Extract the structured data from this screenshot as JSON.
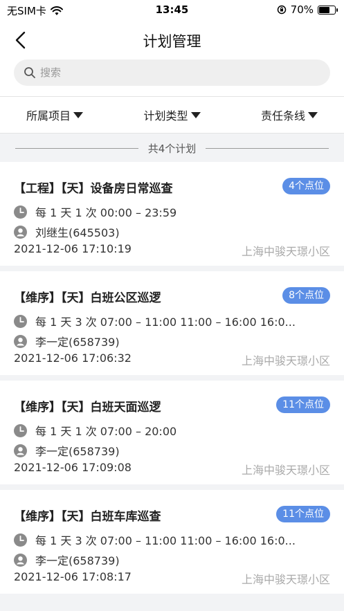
{
  "status_bar": {
    "carrier": "无SIM卡",
    "time": "13:45",
    "battery": "70%",
    "battery_level": 0.7
  },
  "header": {
    "title": "计划管理",
    "search_placeholder": "搜索"
  },
  "filters": [
    {
      "label": "所属项目"
    },
    {
      "label": "计划类型"
    },
    {
      "label": "责任条线"
    }
  ],
  "summary": "共4个计划",
  "plans": [
    {
      "name": "【工程】【天】设备房日常巡查",
      "badge": "4个点位",
      "frequency": "每 1 天 1 次   00:00 – 23:59",
      "person": "刘继生(645503)",
      "datetime": "2021-12-06 17:10:19",
      "area": "上海中骏天璟小区"
    },
    {
      "name": "【维序】【天】白班公区巡逻",
      "badge": "8个点位",
      "frequency": "每 1 天 3 次   07:00 – 11:00   11:00 – 16:00   16:0...",
      "person": "李一定(658739)",
      "datetime": "2021-12-06 17:06:32",
      "area": "上海中骏天璟小区"
    },
    {
      "name": "【维序】【天】白班天面巡逻",
      "badge": "11个点位",
      "frequency": "每 1 天 1 次   07:00 – 20:00",
      "person": "李一定(658739)",
      "datetime": "2021-12-06 17:09:08",
      "area": "上海中骏天璟小区"
    },
    {
      "name": "【维序】【天】白班车库巡查",
      "badge": "11个点位",
      "frequency": "每 1 天 3 次   07:00 – 11:00   11:00 – 16:00   16:0...",
      "person": "李一定(658739)",
      "datetime": "2021-12-06 17:08:17",
      "area": "上海中骏天璟小区"
    }
  ],
  "colors": {
    "accent": "#5b8ee6",
    "icon_gray": "#8a8a8a",
    "muted_text": "#aaaaaa",
    "page_bg": "#f2f3f5"
  }
}
